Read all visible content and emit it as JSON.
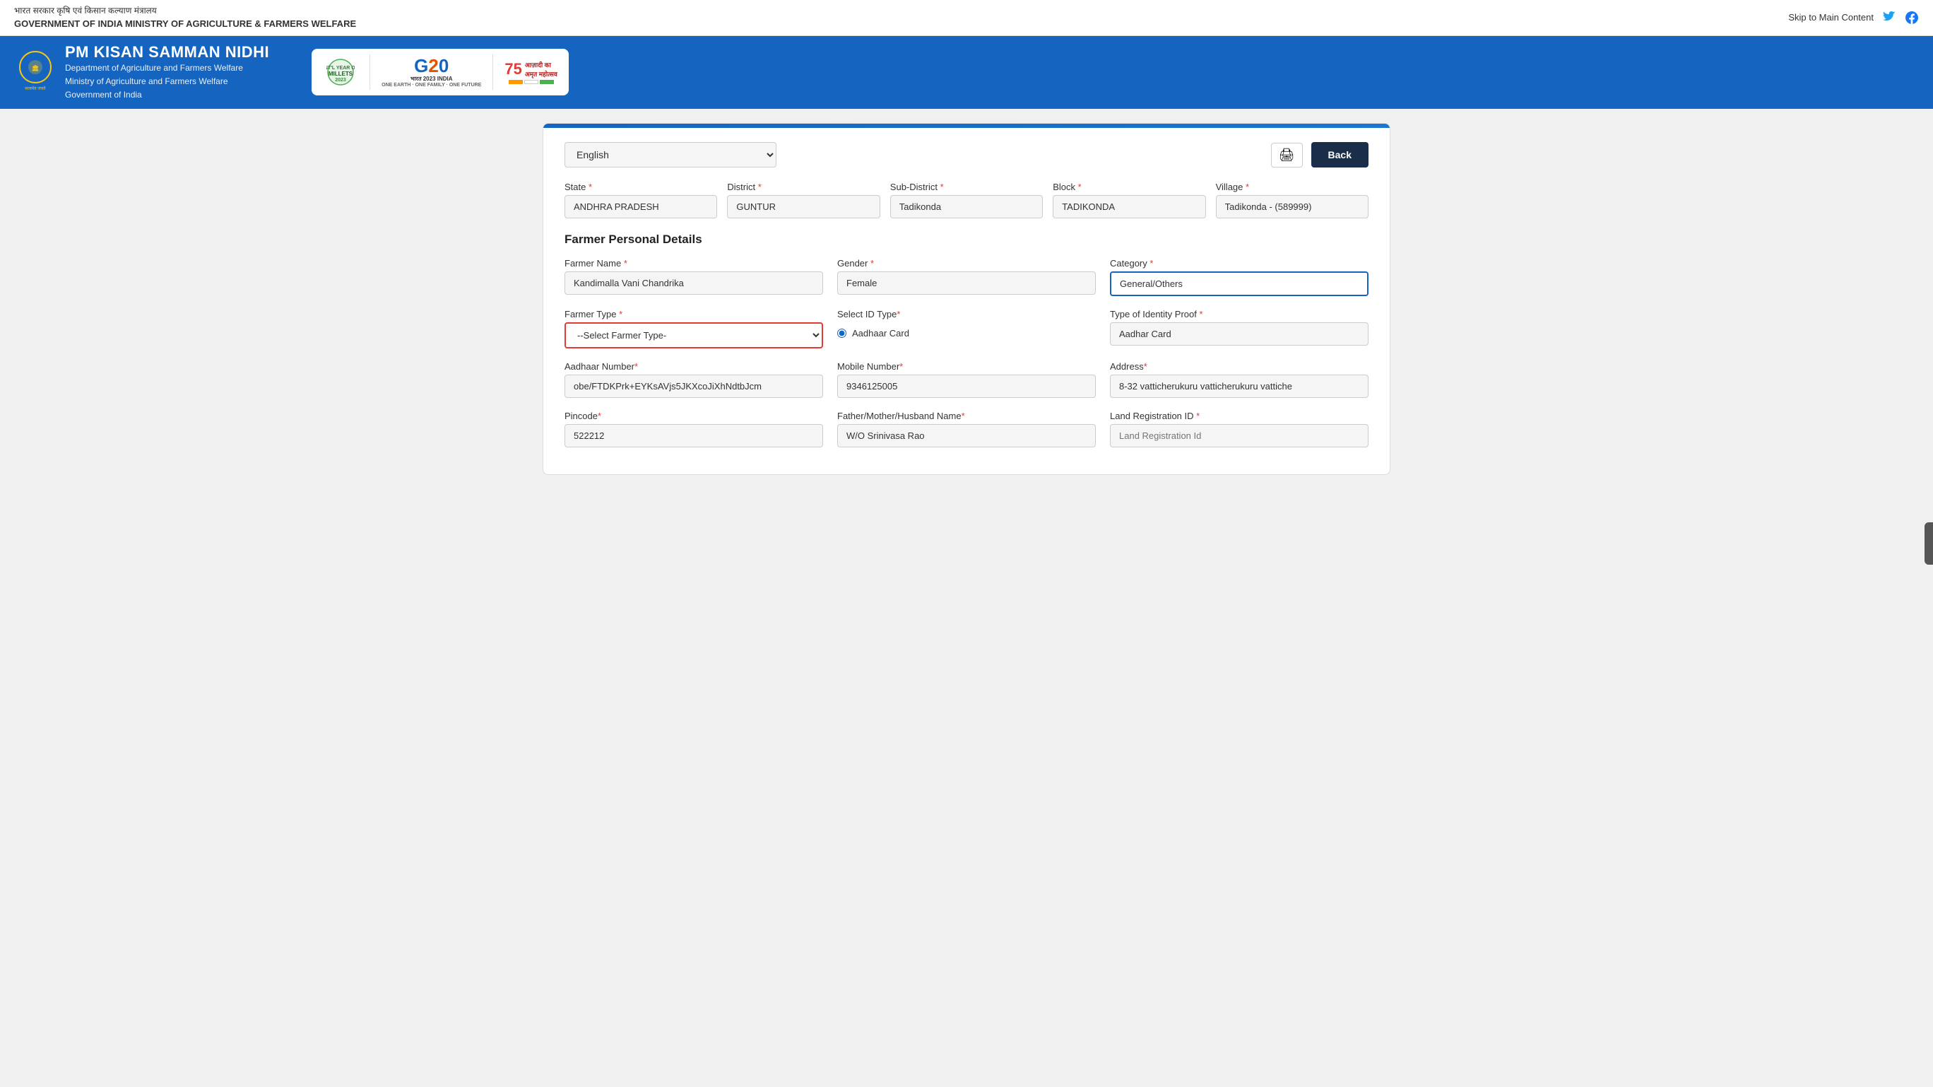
{
  "topbar": {
    "hindi_text": "भारत सरकार   कृषि एवं किसान कल्याण मंत्रालय",
    "english_text": "GOVERNMENT OF INDIA   MINISTRY OF AGRICULTURE & FARMERS WELFARE",
    "skip_link": "Skip to Main Content",
    "twitter_icon": "🐦",
    "facebook_icon": "f"
  },
  "header": {
    "title": "PM KISAN SAMMAN NIDHI",
    "subtitle1": "Department of Agriculture and Farmers Welfare",
    "subtitle2": "Ministry of Agriculture and Farmers Welfare",
    "subtitle3": "Government of India",
    "millets_line1": "INTERNATIONAL YEAR OF",
    "millets_line2": "MILLETS",
    "millets_year": "2023",
    "g20_text": "G20",
    "g20_sub": "भारत 2023 INDIA",
    "g20_tagline": "ONE EARTH · ONE FAMILY · ONE FUTURE",
    "azadi_line1": "आज़ादी का",
    "azadi_line2": "अमृत महोत्सव",
    "india_75": "75"
  },
  "controls": {
    "language_value": "English",
    "print_icon": "🖨",
    "back_label": "Back"
  },
  "location": {
    "state_label": "State",
    "state_value": "ANDHRA PRADESH",
    "district_label": "District",
    "district_value": "GUNTUR",
    "subdistrict_label": "Sub-District",
    "subdistrict_value": "Tadikonda",
    "block_label": "Block",
    "block_value": "TADIKONDA",
    "village_label": "Village",
    "village_value": "Tadikonda - (589999)"
  },
  "farmer": {
    "section_title": "Farmer Personal Details",
    "name_label": "Farmer Name",
    "name_value": "Kandimalla Vani Chandrika",
    "gender_label": "Gender",
    "gender_value": "Female",
    "category_label": "Category",
    "category_value": "General/Others",
    "farmer_type_label": "Farmer Type",
    "farmer_type_placeholder": "--Select Farmer Type-",
    "id_type_label": "Select ID Type",
    "id_type_value": "Aadhaar Card",
    "id_type_radio": "Aadhaar Card",
    "identity_proof_label": "Type of Identity Proof",
    "identity_proof_value": "Aadhar Card",
    "aadhaar_label": "Aadhaar Number",
    "aadhaar_value": "obe/FTDKPrk+EYKsAVjs5JKXcoJiXhNdtbJcm",
    "mobile_label": "Mobile Number",
    "mobile_value": "9346125005",
    "address_label": "Address",
    "address_value": "8-32 vatticherukuru vatticherukuru vattiche",
    "pincode_label": "Pincode",
    "pincode_value": "522212",
    "fmh_label": "Father/Mother/Husband Name",
    "fmh_value": "W/O Srinivasa Rao",
    "land_reg_label": "Land Registration ID",
    "land_reg_placeholder": "Land Registration Id"
  }
}
